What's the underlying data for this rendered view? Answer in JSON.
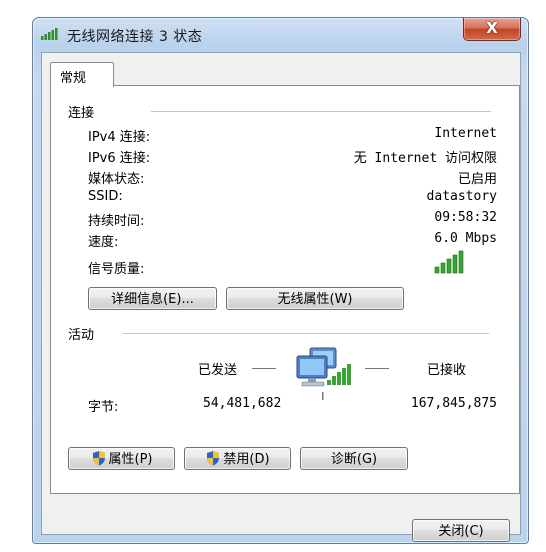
{
  "window": {
    "title": "无线网络连接 3 状态",
    "close_glyph": "X"
  },
  "tab": {
    "label": "常规"
  },
  "connection": {
    "section_label": "连接",
    "rows": [
      {
        "label": "IPv4 连接:",
        "value": "Internet"
      },
      {
        "label": "IPv6 连接:",
        "value": "无 Internet 访问权限"
      },
      {
        "label": "媒体状态:",
        "value": "已启用"
      },
      {
        "label": "SSID:",
        "value": "datastory"
      },
      {
        "label": "持续时间:",
        "value": "09:58:32"
      },
      {
        "label": "速度:",
        "value": "6.0 Mbps"
      }
    ],
    "signal_label": "信号质量:",
    "signal_bars": 5,
    "signal_strength": 5,
    "details_button": "详细信息(E)...",
    "wireless_props_button": "无线属性(W)"
  },
  "activity": {
    "section_label": "活动",
    "sent_label": "已发送",
    "received_label": "已接收",
    "bytes_label": "字节:",
    "bytes_sent": "54,481,682",
    "bytes_received": "167,845,875"
  },
  "buttons": {
    "properties": "属性(P)",
    "disable": "禁用(D)",
    "diagnose": "诊断(G)",
    "close": "关闭(C)"
  },
  "colors": {
    "signal_green": "#3aa335",
    "titlebar_blue": "#b9d1ec",
    "close_red": "#c24528"
  }
}
